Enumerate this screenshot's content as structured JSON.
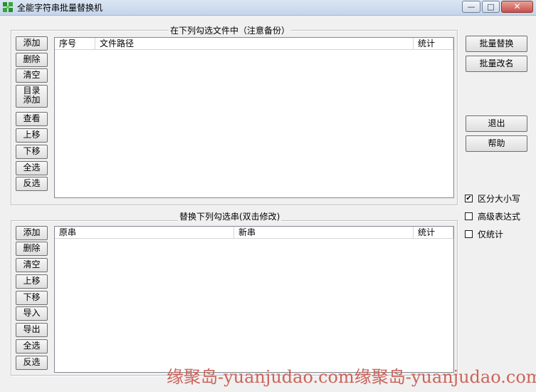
{
  "window": {
    "title": "全能字符串批量替换机",
    "controls": {
      "minimize": "—",
      "maximize": "□",
      "close": "✕"
    }
  },
  "files_group": {
    "title": "在下列勾选文件中（注意备份）",
    "buttons": [
      "添加",
      "删除",
      "清空",
      "目录\n添加",
      "查看",
      "上移",
      "下移",
      "全选",
      "反选"
    ],
    "columns": [
      "序号",
      "文件路径",
      "统计"
    ]
  },
  "strings_group": {
    "title": "替换下列勾选串(双击修改)",
    "buttons": [
      "添加",
      "删除",
      "清空",
      "上移",
      "下移",
      "导入",
      "导出",
      "全选",
      "反选"
    ],
    "columns": [
      "原串",
      "新串",
      "统计"
    ]
  },
  "side_buttons": {
    "batch_replace": "批量替换",
    "batch_rename": "批量改名",
    "exit": "退出",
    "help": "帮助"
  },
  "options": [
    {
      "label": "区分大小写",
      "checked": true
    },
    {
      "label": "高级表达式",
      "checked": false
    },
    {
      "label": "仅统计",
      "checked": false
    }
  ],
  "watermark": "缘聚岛-yuanjudao.com缘聚岛-yuanjudao.com",
  "colors": {
    "watermark": "#c9554b",
    "titlebar": "#c5d5ea"
  }
}
